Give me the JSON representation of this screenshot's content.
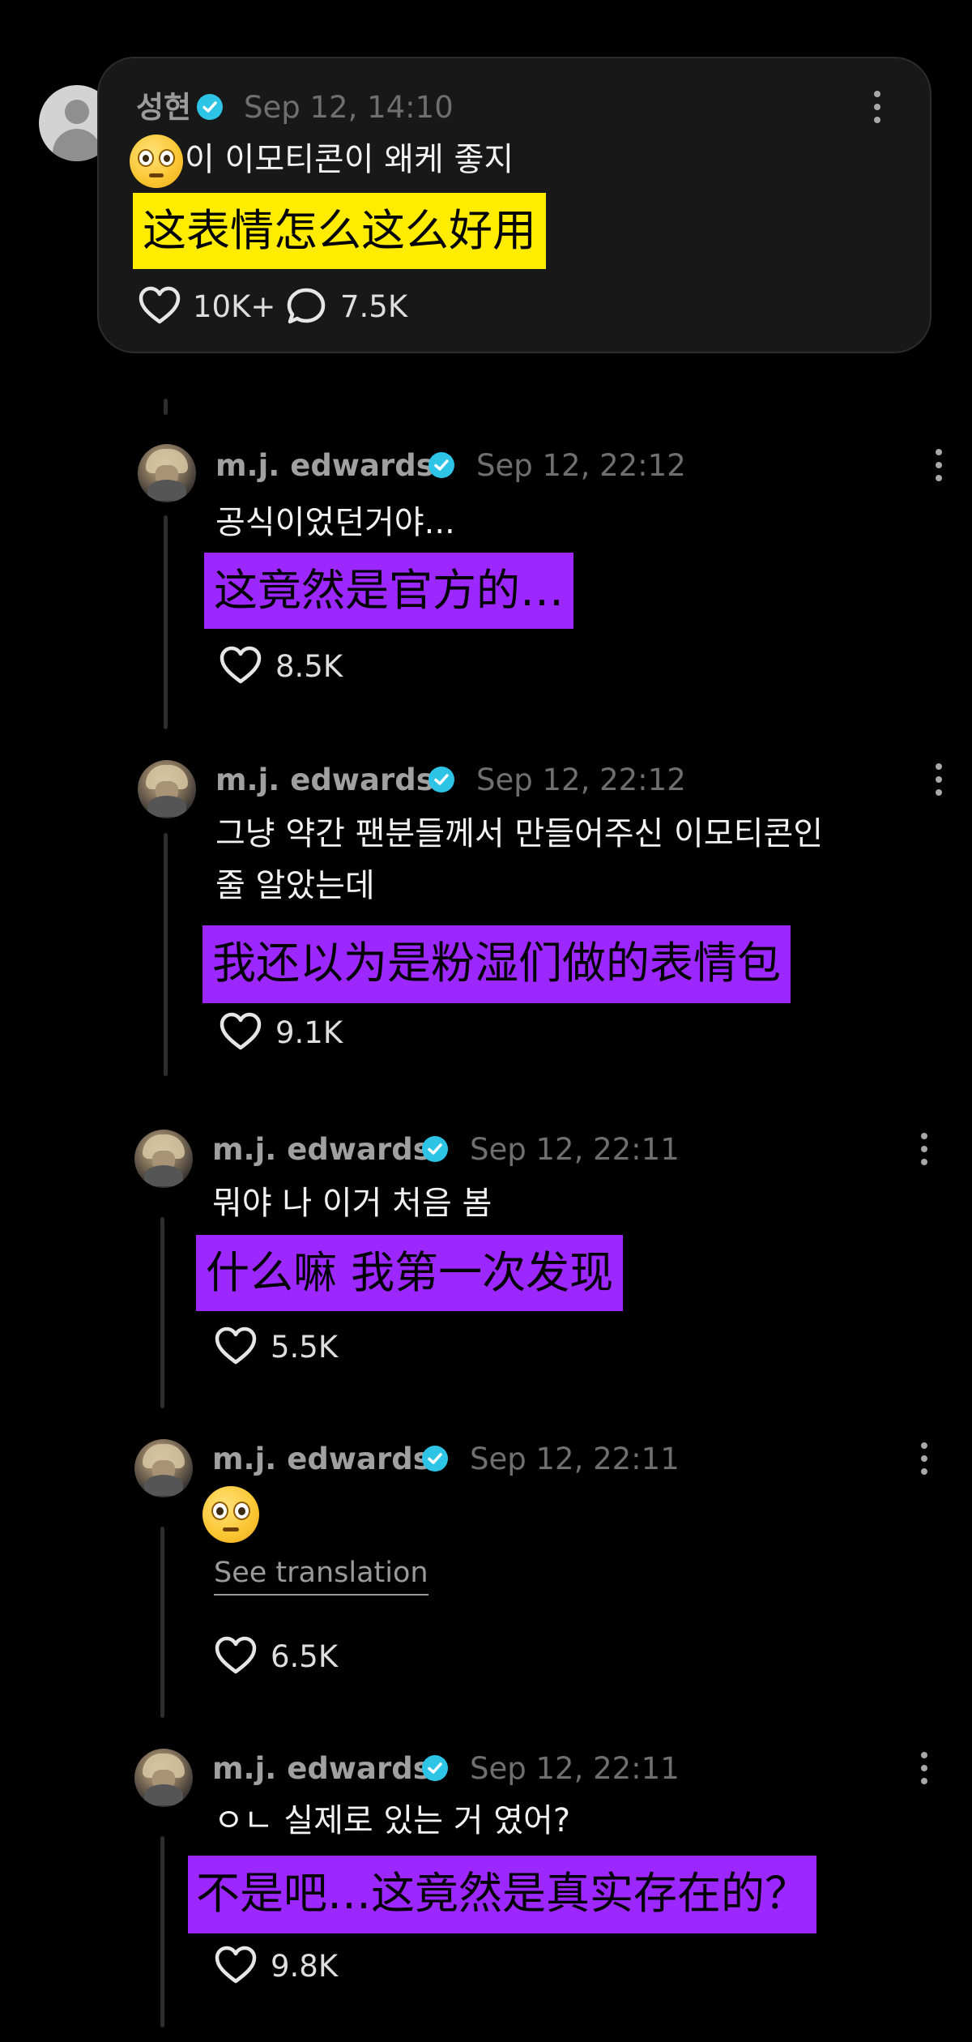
{
  "post": {
    "username": "성현",
    "timestamp": "Sep 12, 14:10",
    "text": "이 이모티콘이 왜케 좋지",
    "translation": "这表情怎么这么好用",
    "likes": "10K+",
    "comments": "7.5K",
    "colors": {
      "highlight": "#ffec00",
      "verified": "#2ec4e6"
    }
  },
  "replies": [
    {
      "username": "m.j. edwards",
      "timestamp": "Sep 12, 22:12",
      "text_lines": [
        "공식이었던거야..."
      ],
      "translation": "这竟然是官方的…",
      "likes": "8.5K"
    },
    {
      "username": "m.j. edwards",
      "timestamp": "Sep 12, 22:12",
      "text_lines": [
        "그냥 약간 팬분들께서 만들어주신 이모티콘인",
        "줄 알았는데"
      ],
      "translation": "我还以为是粉湿们做的表情包",
      "likes": "9.1K"
    },
    {
      "username": "m.j. edwards",
      "timestamp": "Sep 12, 22:11",
      "text_lines": [
        "뭐야 나 이거 처음 봄"
      ],
      "translation": "什么嘛  我第一次发现",
      "likes": "5.5K"
    },
    {
      "username": "m.j. edwards",
      "timestamp": "Sep 12, 22:11",
      "see_translation": "See translation",
      "likes": "6.5K"
    },
    {
      "username": "m.j. edwards",
      "timestamp": "Sep 12, 22:11",
      "text_lines": [
        "ㅇㄴ 실제로 있는 거 였어?"
      ],
      "translation": "不是吧…这竟然是真实存在的？",
      "likes": "9.8K"
    }
  ],
  "icons": [
    "verified-badge-icon",
    "more-options-icon",
    "heart-icon",
    "comment-icon",
    "flushed-face-emoji"
  ],
  "colors": {
    "background": "#000000",
    "card": "#181818",
    "translation_highlight": "#9c28ff"
  }
}
